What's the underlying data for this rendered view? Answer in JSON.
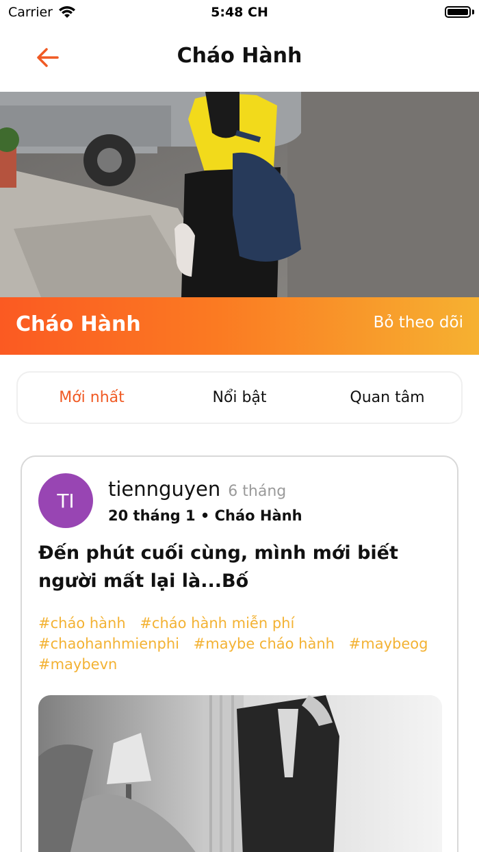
{
  "status_bar": {
    "carrier": "Carrier",
    "time": "5:48 CH"
  },
  "header": {
    "title": "Cháo Hành",
    "back_icon": "arrow-left-icon",
    "accent": "#f05a24"
  },
  "banner": {
    "title": "Cháo Hành",
    "unfollow_label": "Bỏ theo dõi",
    "gradient_start": "#fb5a22",
    "gradient_end": "#f6b131"
  },
  "tabs": [
    {
      "label": "Mới nhất",
      "active": true
    },
    {
      "label": "Nổi bật",
      "active": false
    },
    {
      "label": "Quan tâm",
      "active": false
    }
  ],
  "post": {
    "avatar_initials": "TI",
    "avatar_color": "#9845b3",
    "author": "tiennguyen",
    "time_ago": "6 tháng",
    "meta": "20 tháng 1 • Cháo Hành",
    "title": "Đến phút cuối cùng, mình mới biết người mất lại là...Bố",
    "tags": [
      "#cháo hành",
      "#cháo hành miễn phí",
      "#chaohanhmienphi",
      "#maybe cháo hành",
      "#maybeog",
      "#maybevn"
    ],
    "tag_color": "#f3b233"
  }
}
